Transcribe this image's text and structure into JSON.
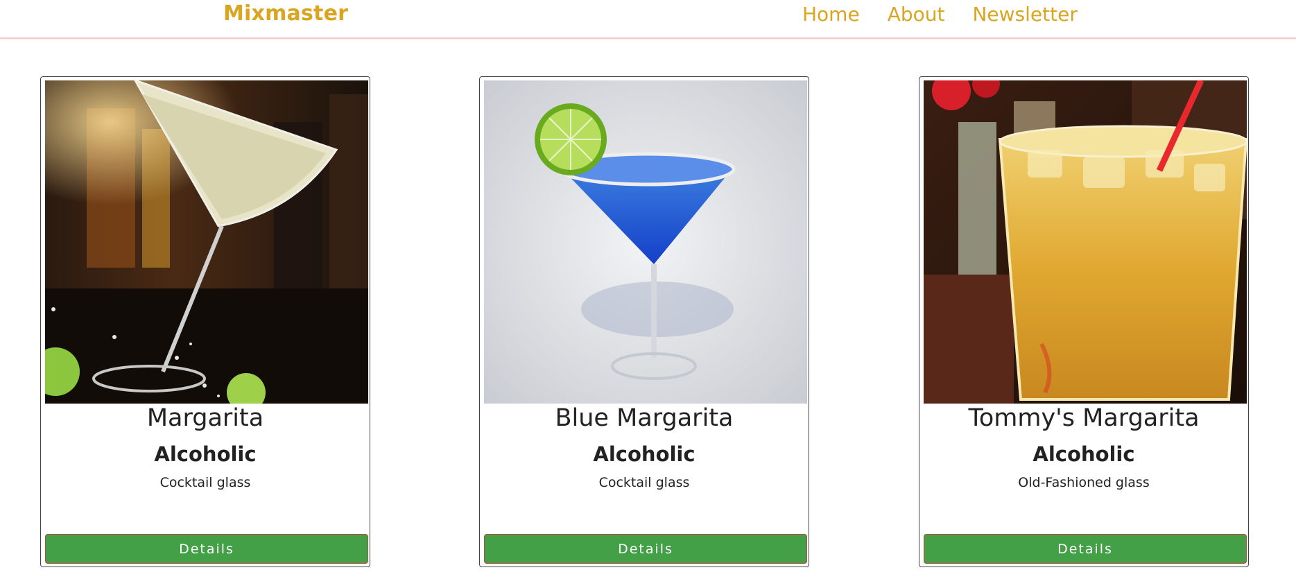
{
  "navbar": {
    "brand": "Mixmaster",
    "links": [
      {
        "label": "Home"
      },
      {
        "label": "About"
      },
      {
        "label": "Newsletter"
      }
    ],
    "colors": {
      "brand": "#daa520",
      "underline": "#f7c9cf"
    }
  },
  "cocktails": [
    {
      "name": "Margarita",
      "category": "Alcoholic",
      "glass": "Cocktail glass",
      "button": "Details",
      "image": "margarita-photo"
    },
    {
      "name": "Blue Margarita",
      "category": "Alcoholic",
      "glass": "Cocktail glass",
      "button": "Details",
      "image": "blue-margarita-photo"
    },
    {
      "name": "Tommy's Margarita",
      "category": "Alcoholic",
      "glass": "Old-Fashioned glass",
      "button": "Details",
      "image": "tommys-margarita-photo"
    }
  ],
  "colors": {
    "button": "#43a047",
    "button_border": "#b84a3c"
  }
}
